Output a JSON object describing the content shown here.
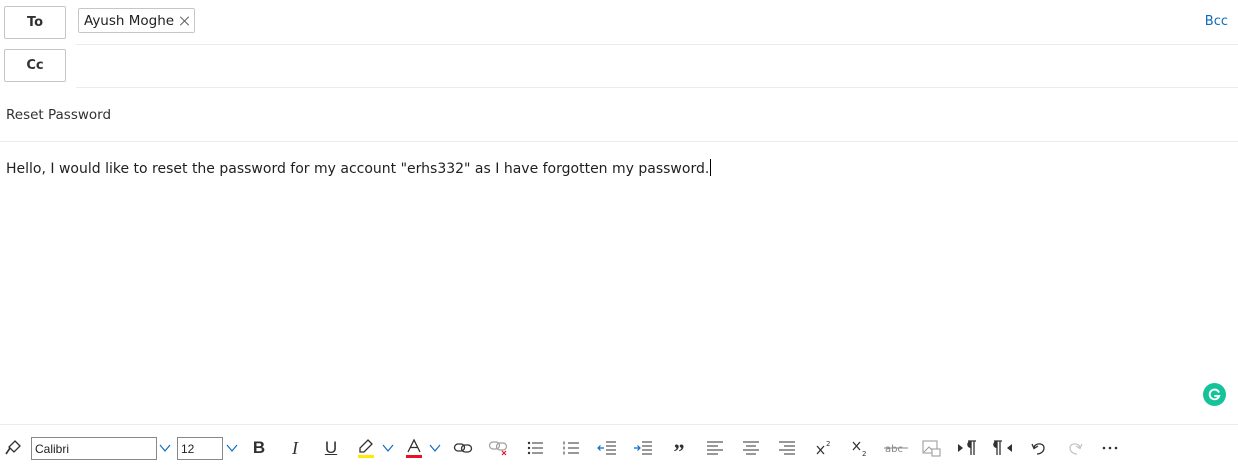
{
  "compose": {
    "to_label": "To",
    "cc_label": "Cc",
    "bcc_label": "Bcc",
    "recipients": [
      {
        "name": "Ayush Moghe"
      }
    ],
    "subject": "Reset Password",
    "body": "Hello, I would like to reset the password for my account \"erhs332\" as I have forgotten my password."
  },
  "toolbar": {
    "font_name": "Calibri",
    "font_size": "12",
    "items": [
      "format-painter",
      "bold",
      "italic",
      "underline",
      "highlight",
      "font-color",
      "insert-link",
      "remove-link",
      "bullets",
      "numbering",
      "decrease-indent",
      "increase-indent",
      "quote",
      "align-left",
      "align-center",
      "align-right",
      "superscript",
      "subscript",
      "strikethrough",
      "insert-image",
      "ltr",
      "rtl",
      "undo",
      "redo",
      "more"
    ]
  },
  "colors": {
    "accent": "#0f6cbd",
    "grammarly": "#15c39a",
    "highlight": "#ffeb00",
    "font_color": "#e81123"
  }
}
